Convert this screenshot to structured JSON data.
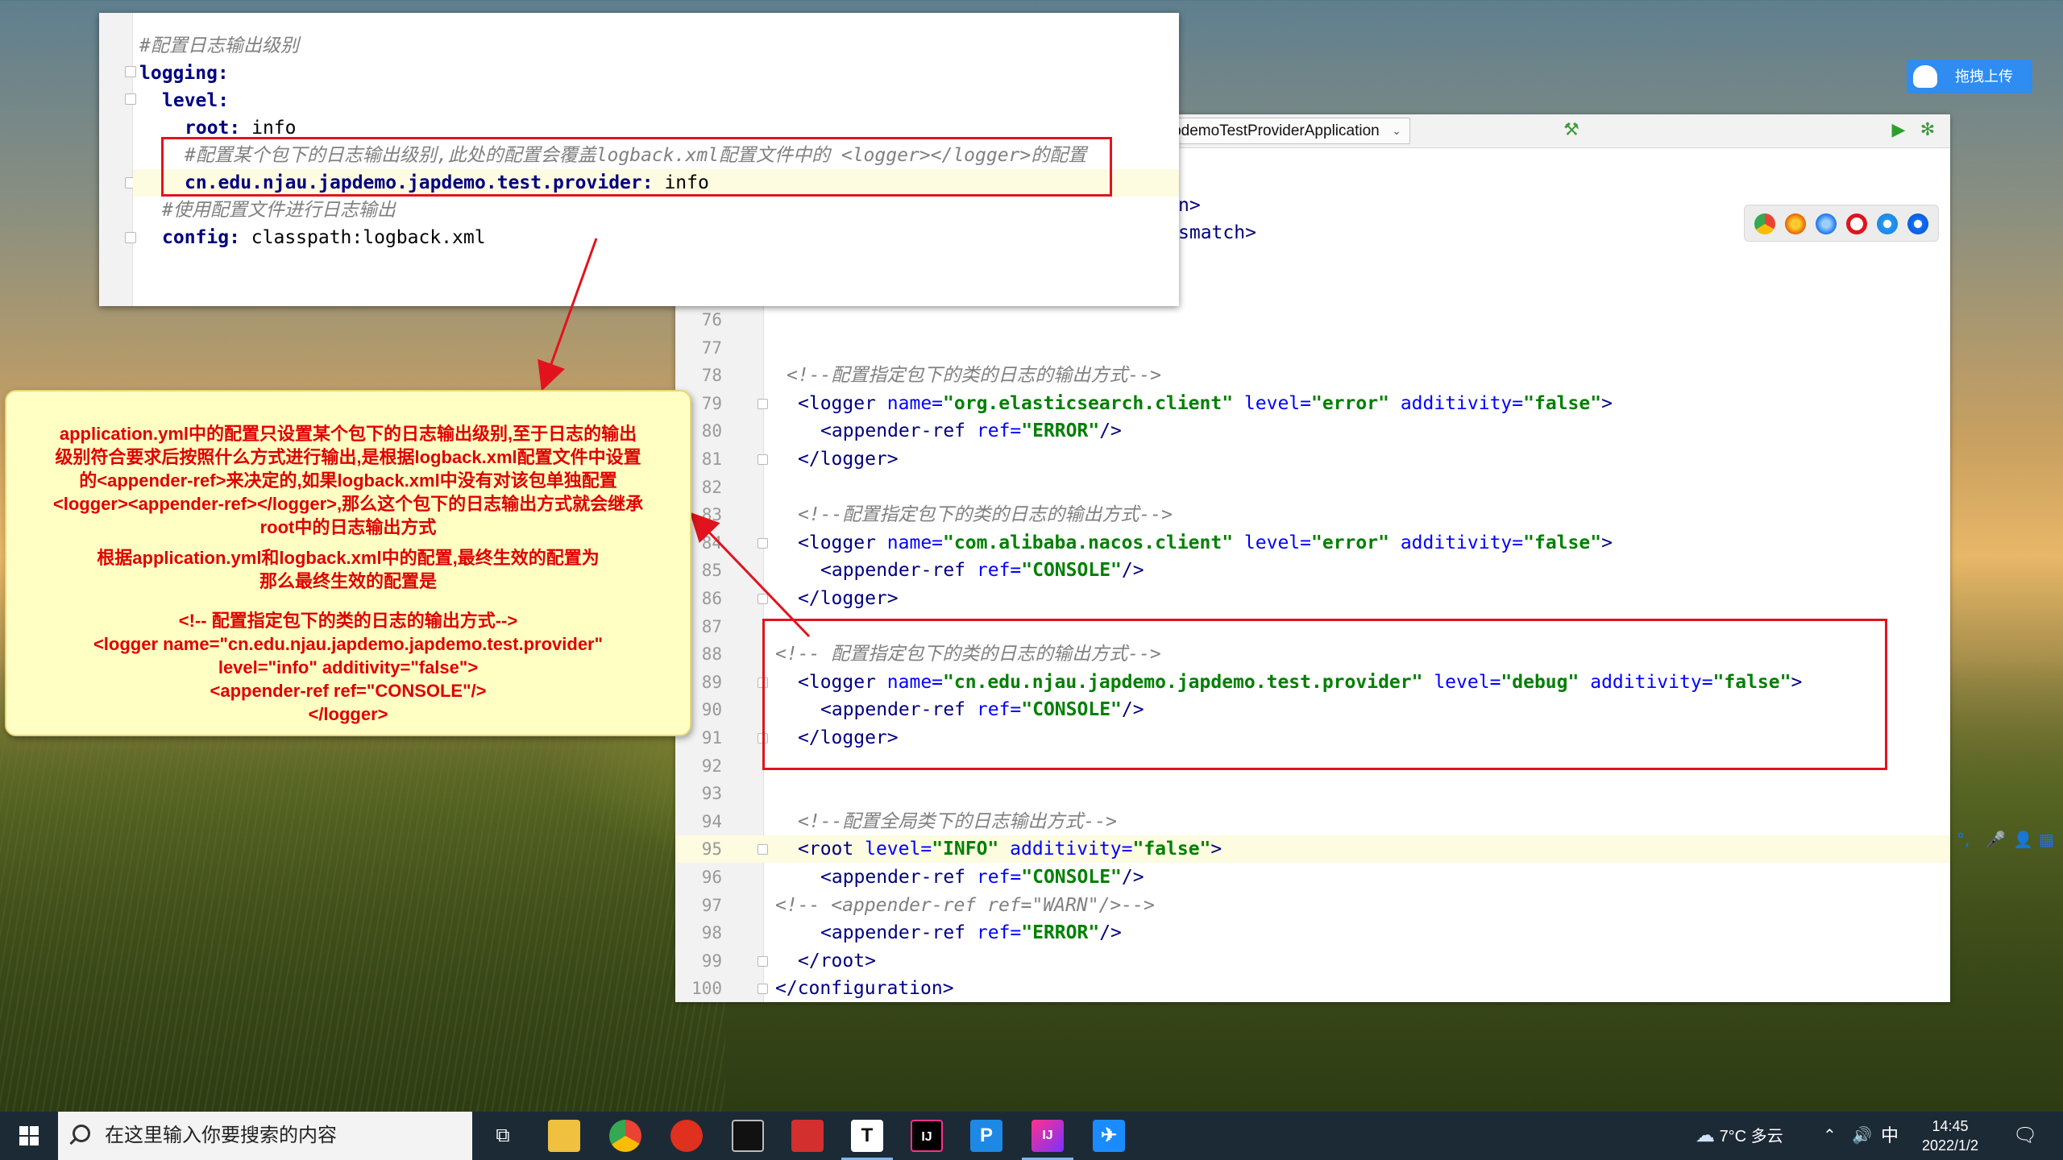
{
  "yml": {
    "lines": [
      {
        "comment": "#配置日志输出级别"
      },
      {
        "key": "logging:"
      },
      {
        "key": "level:"
      },
      {
        "key": "root:",
        "value": " info"
      },
      {
        "comment": "#配置某个包下的日志输出级别,此处的配置会覆盖logback.xml配置文件中的 <logger></logger>的配置"
      },
      {
        "key": "cn.edu.njau.japdemo.japdemo.test.provider:",
        "value": " info"
      },
      {
        "comment": "#使用配置文件进行日志输出"
      },
      {
        "key": "config:",
        "value": " classpath:logback.xml"
      }
    ]
  },
  "callout": {
    "lines": [
      "application.yml中的配置只设置某个包下的日志输出级别,至于日志的输出",
      "级别符合要求后按照什么方式进行输出,是根据logback.xml配置文件中设置",
      "的<appender-ref>来决定的,如果logback.xml中没有对该包单独配置",
      "<logger><appender-ref></logger>,那么这个包下的日志输出方式就会继承",
      "root中的日志输出方式",
      "根据application.yml和logback.xml中的配置,最终生效的配置为",
      "那么最终生效的配置是",
      "<!--    配置指定包下的类的日志的输出方式-->",
      "<logger name=\"cn.edu.njau.japdemo.japdemo.test.provider\"",
      "level=\"info\" additivity=\"false\">",
      "<appender-ref ref=\"CONSOLE\"/>",
      "</logger>"
    ]
  },
  "ide": {
    "run_config": "JapdemoTestProviderApplication",
    "partial_lines": [
      "n>",
      "smatch>"
    ],
    "code": [
      {
        "n": "76",
        "html": ""
      },
      {
        "n": "77",
        "html": ""
      },
      {
        "n": "78",
        "indent": 1,
        "parts": [
          [
            "xcm",
            "<!--配置指定包下的类的日志的输出方式-->"
          ]
        ]
      },
      {
        "n": "79",
        "indent": 2,
        "fold": true,
        "parts": [
          [
            "tag",
            "<logger "
          ],
          [
            "attr",
            "name="
          ],
          [
            "str",
            "\"org.elasticsearch.client\""
          ],
          [
            "tag",
            " "
          ],
          [
            "attr",
            "level="
          ],
          [
            "str",
            "\"error\""
          ],
          [
            "tag",
            " "
          ],
          [
            "attr",
            "additivity="
          ],
          [
            "str",
            "\"false\""
          ],
          [
            "tag",
            ">"
          ]
        ]
      },
      {
        "n": "80",
        "indent": 4,
        "parts": [
          [
            "tag",
            "<appender-ref "
          ],
          [
            "attr",
            "ref="
          ],
          [
            "str",
            "\"ERROR\""
          ],
          [
            "tag",
            "/>"
          ]
        ]
      },
      {
        "n": "81",
        "indent": 2,
        "fold": true,
        "parts": [
          [
            "tag",
            "</logger>"
          ]
        ]
      },
      {
        "n": "82",
        "html": ""
      },
      {
        "n": "83",
        "indent": 2,
        "parts": [
          [
            "xcm",
            "<!--配置指定包下的类的日志的输出方式-->"
          ]
        ]
      },
      {
        "n": "84",
        "indent": 2,
        "fold": true,
        "parts": [
          [
            "tag",
            "<logger "
          ],
          [
            "attr",
            "name="
          ],
          [
            "str",
            "\"com.alibaba.nacos.client\""
          ],
          [
            "tag",
            " "
          ],
          [
            "attr",
            "level="
          ],
          [
            "str",
            "\"error\""
          ],
          [
            "tag",
            " "
          ],
          [
            "attr",
            "additivity="
          ],
          [
            "str",
            "\"false\""
          ],
          [
            "tag",
            ">"
          ]
        ]
      },
      {
        "n": "85",
        "indent": 4,
        "parts": [
          [
            "tag",
            "<appender-ref "
          ],
          [
            "attr",
            "ref="
          ],
          [
            "str",
            "\"CONSOLE\""
          ],
          [
            "tag",
            "/>"
          ]
        ]
      },
      {
        "n": "86",
        "indent": 2,
        "fold": true,
        "parts": [
          [
            "tag",
            "</logger>"
          ]
        ]
      },
      {
        "n": "87",
        "html": ""
      },
      {
        "n": "88",
        "indent": 0,
        "parts": [
          [
            "xcm",
            "<!--     配置指定包下的类的日志的输出方式-->"
          ]
        ]
      },
      {
        "n": "89",
        "indent": 2,
        "fold": true,
        "parts": [
          [
            "tag",
            "<logger "
          ],
          [
            "attr",
            "name="
          ],
          [
            "str",
            "\"cn.edu.njau.japdemo.japdemo.test.provider\""
          ],
          [
            "tag",
            " "
          ],
          [
            "attr",
            "level="
          ],
          [
            "str",
            "\"debug\""
          ],
          [
            "tag",
            " "
          ],
          [
            "attr",
            "additivity="
          ],
          [
            "str",
            "\"false\""
          ],
          [
            "tag",
            ">"
          ]
        ]
      },
      {
        "n": "90",
        "indent": 4,
        "parts": [
          [
            "tag",
            "<appender-ref "
          ],
          [
            "attr",
            "ref="
          ],
          [
            "str",
            "\"CONSOLE\""
          ],
          [
            "tag",
            "/>"
          ]
        ]
      },
      {
        "n": "91",
        "indent": 2,
        "fold": true,
        "parts": [
          [
            "tag",
            "</logger>"
          ]
        ]
      },
      {
        "n": "92",
        "html": ""
      },
      {
        "n": "93",
        "html": ""
      },
      {
        "n": "94",
        "indent": 2,
        "parts": [
          [
            "xcm",
            "<!--配置全局类下的日志输出方式-->"
          ]
        ]
      },
      {
        "n": "95",
        "indent": 2,
        "fold": true,
        "hl": true,
        "parts": [
          [
            "tag",
            "<root "
          ],
          [
            "attr",
            "level="
          ],
          [
            "str",
            "\"INFO\""
          ],
          [
            "tag",
            " "
          ],
          [
            "attr",
            "additivity="
          ],
          [
            "str",
            "\"false\""
          ],
          [
            "tag",
            ">"
          ]
        ]
      },
      {
        "n": "96",
        "indent": 4,
        "parts": [
          [
            "tag",
            "<appender-ref "
          ],
          [
            "attr",
            "ref="
          ],
          [
            "str",
            "\"CONSOLE\""
          ],
          [
            "tag",
            "/>"
          ]
        ]
      },
      {
        "n": "97",
        "indent": 0,
        "parts": [
          [
            "xcm",
            "<!--        <appender-ref ref=\"WARN\"/>-->"
          ]
        ]
      },
      {
        "n": "98",
        "indent": 4,
        "parts": [
          [
            "tag",
            "<appender-ref "
          ],
          [
            "attr",
            "ref="
          ],
          [
            "str",
            "\"ERROR\""
          ],
          [
            "tag",
            "/>"
          ]
        ]
      },
      {
        "n": "99",
        "indent": 2,
        "fold": true,
        "parts": [
          [
            "tag",
            "</root>"
          ]
        ]
      },
      {
        "n": "100",
        "indent": 0,
        "fold": true,
        "parts": [
          [
            "tag",
            "</configuration>"
          ]
        ]
      }
    ]
  },
  "upload": {
    "label": "拖拽上传"
  },
  "taskbar": {
    "search_placeholder": "在这里输入你要搜索的内容",
    "weather": "7°C 多云",
    "ime": "中",
    "time": "14:45",
    "date": "2022/1/2"
  },
  "colors": {
    "annotation_red": "#e1141e",
    "callout_bg": "#ffffc4",
    "taskbar_bg": "#1c2a36",
    "accent_blue": "#2f8cf0"
  }
}
